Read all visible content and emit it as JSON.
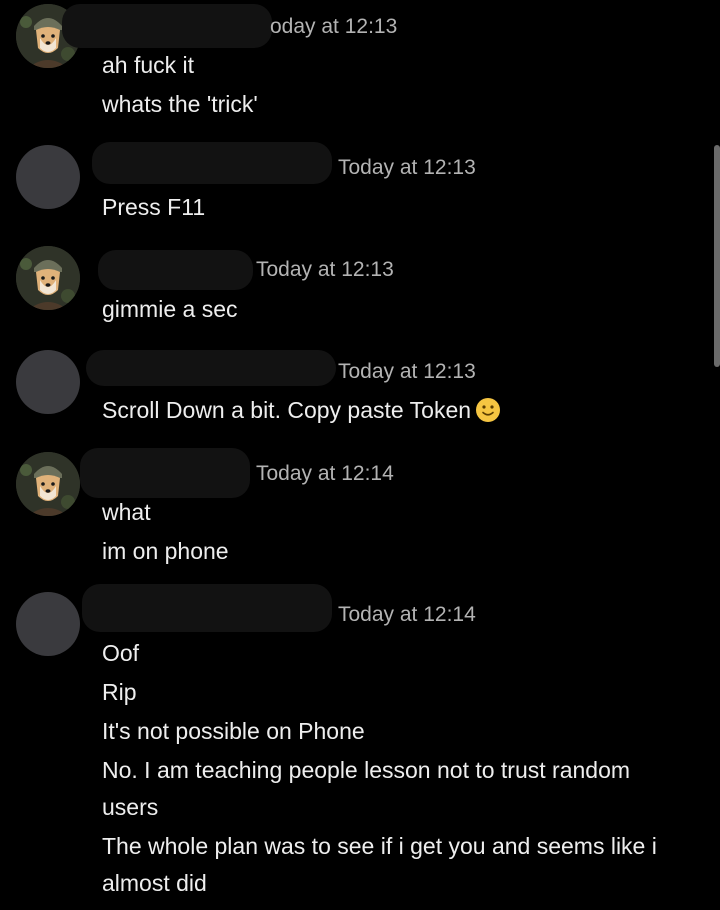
{
  "messages": [
    {
      "avatar": "dog-avatar",
      "timestamp": "oday at 12:13",
      "lines": [
        "ah fuck it",
        "whats the 'trick'"
      ]
    },
    {
      "avatar": "default-avatar",
      "timestamp": "Today at 12:13",
      "lines": [
        "Press F11"
      ]
    },
    {
      "avatar": "dog-avatar",
      "timestamp": "Today at 12:13",
      "lines": [
        "gimmie a sec"
      ]
    },
    {
      "avatar": "default-avatar",
      "timestamp": "Today at 12:13",
      "lines": [
        "Scroll Down a bit. Copy paste Token"
      ],
      "emoji": "slightly-smiling-face-icon"
    },
    {
      "avatar": "dog-avatar",
      "timestamp": "Today at 12:14",
      "lines": [
        "what",
        "im on phone"
      ]
    },
    {
      "avatar": "default-avatar",
      "timestamp": "Today at 12:14",
      "lines": [
        "Oof",
        "Rip",
        "It's not possible on Phone",
        "No. I am teaching people lesson not to trust random",
        "users",
        "The whole plan was to see if i get  you and seems like i",
        "almost did"
      ]
    }
  ],
  "colors": {
    "background": "#000000",
    "text": "#eeeeee",
    "timestamp": "#b3b3b3",
    "default_avatar": "#3a3a3e",
    "emoji": "#f5c542"
  }
}
